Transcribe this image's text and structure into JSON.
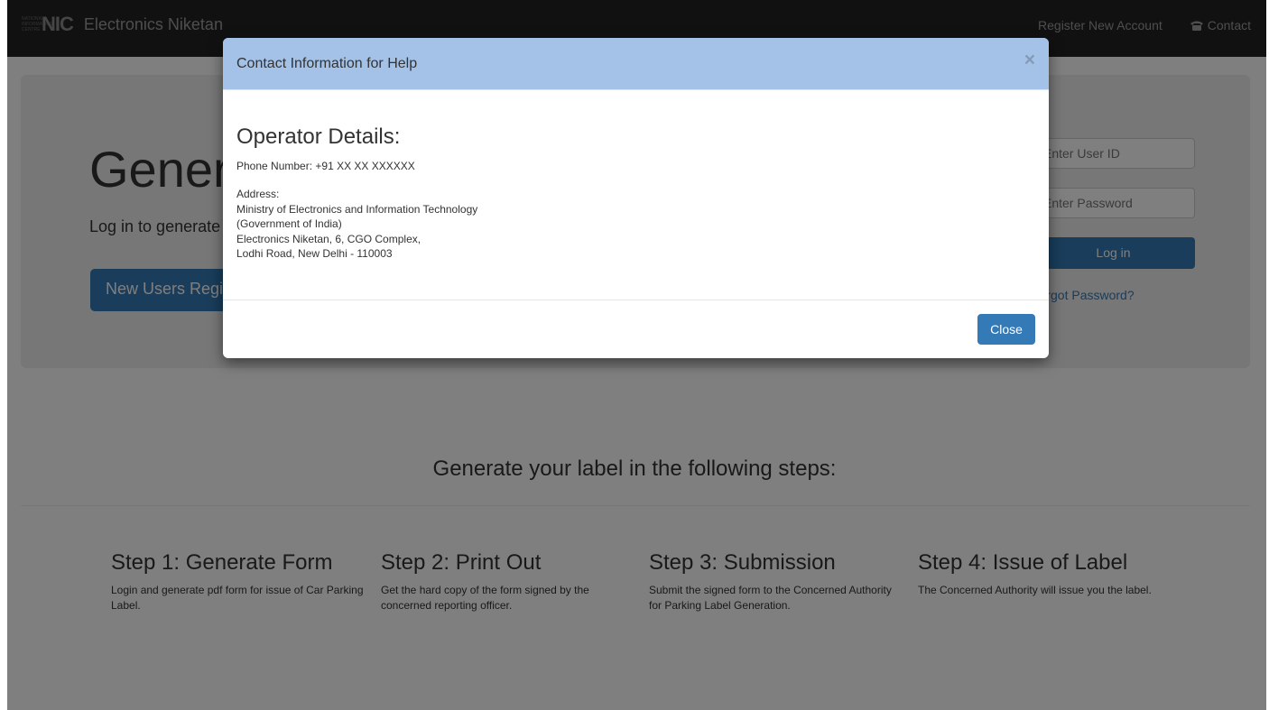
{
  "navbar": {
    "logo_small_text": "NATIONAL INFORMATICS CENTRE",
    "logo_mark": "NIC",
    "brand": "Electronics Niketan",
    "register_link": "Register New Account",
    "contact_link": "Contact",
    "contact_icon": "phone-icon"
  },
  "jumbotron": {
    "title": "Generate Car Parking Label",
    "subtitle": "Log in to generate",
    "new_users_button": "New Users Register",
    "user_id_placeholder": "Enter User ID",
    "password_placeholder": "Enter Password",
    "login_button": "Log in",
    "forgot_link": "Forgot Password?"
  },
  "steps": {
    "heading": "Generate your label in the following steps:",
    "items": [
      {
        "title": "Step 1: Generate Form",
        "text": "Login and generate pdf form for issue of Car Parking Label."
      },
      {
        "title": "Step 2: Print Out",
        "text": "Get the hard copy of the form signed by the concerned reporting officer."
      },
      {
        "title": "Step 3: Submission",
        "text": "Submit the signed form to the Concerned Authority for Parking Label Generation."
      },
      {
        "title": "Step 4: Issue of Label",
        "text": "The Concerned Authority will issue you the label."
      }
    ]
  },
  "modal": {
    "title": "Contact Information for Help",
    "close_x": "×",
    "operator_heading": "Operator Details:",
    "phone": "Phone Number: +91 XX XX XXXXXX",
    "address_label": "Address:",
    "address_lines": [
      "Ministry of Electronics and Information Technology",
      "(Government of India)",
      "Electronics Niketan, 6, CGO Complex,",
      "Lodhi Road, New Delhi - 110003"
    ],
    "close_button": "Close"
  },
  "colors": {
    "navbar_bg": "#222222",
    "primary": "#337ab7",
    "modal_header_bg": "#a4c2e7",
    "jumbotron_bg": "#eeeeee"
  }
}
